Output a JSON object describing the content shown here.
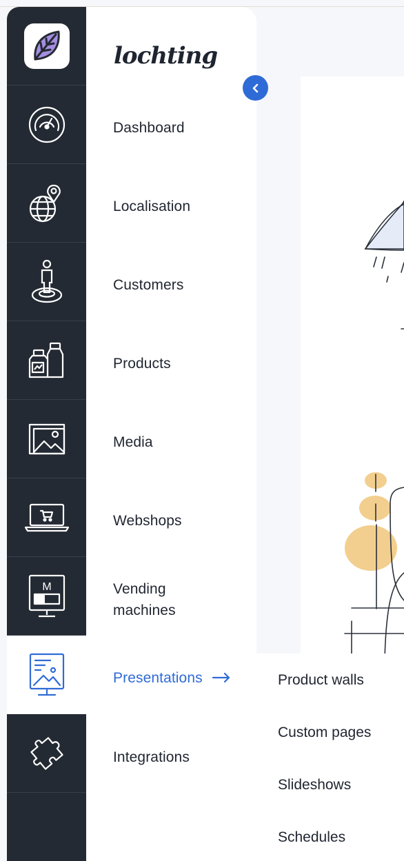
{
  "brand": {
    "wordmark": "lochting"
  },
  "colors": {
    "rail": "#242a33",
    "accent": "#2f6bd6",
    "logo_leaf": "#a58de0",
    "illustration_orange": "#f2cf8e"
  },
  "rail_icons": [
    "app-logo-icon",
    "dashboard-gauge-icon",
    "globe-pin-icon",
    "person-location-icon",
    "bottles-icon",
    "image-icon",
    "laptop-cart-icon",
    "vending-machine-icon",
    "presentation-board-icon",
    "puzzle-icon"
  ],
  "menu": {
    "collapse_icon": "chevron-left-icon",
    "items": [
      {
        "label": "Dashboard"
      },
      {
        "label": "Localisation"
      },
      {
        "label": "Customers"
      },
      {
        "label": "Products"
      },
      {
        "label": "Media"
      },
      {
        "label": "Webshops"
      },
      {
        "label": "Vending machines"
      },
      {
        "label": "Presentations"
      },
      {
        "label": "Integrations"
      }
    ],
    "active": "Presentations"
  },
  "submenu": {
    "items": [
      {
        "label": "Product walls"
      },
      {
        "label": "Custom pages"
      },
      {
        "label": "Slideshows"
      },
      {
        "label": "Schedules"
      }
    ]
  }
}
